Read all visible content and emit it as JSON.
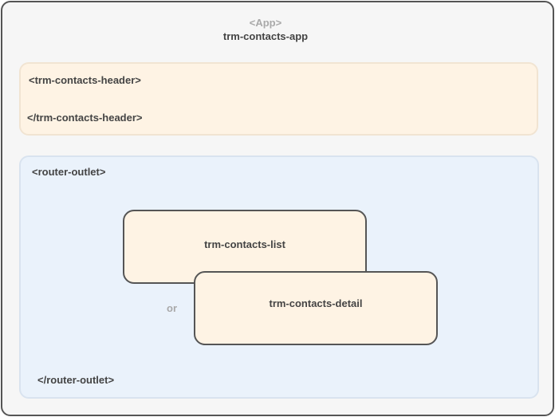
{
  "app": {
    "tag": "<App>",
    "name": "trm-contacts-app"
  },
  "header": {
    "open_tag": "<trm-contacts-header>",
    "close_tag": "</trm-contacts-header>"
  },
  "router_outlet": {
    "open_tag": "<router-outlet>",
    "close_tag": "</router-outlet>",
    "or_label": "or",
    "components": {
      "list": "trm-contacts-list",
      "detail": "trm-contacts-detail"
    }
  },
  "colors": {
    "frame_border": "#555555",
    "frame_fill": "#f6f6f6",
    "component_fill": "#fef3e4",
    "outlet_fill": "#eaf2fb",
    "muted_text": "#a9a9a9",
    "text": "#444444"
  }
}
